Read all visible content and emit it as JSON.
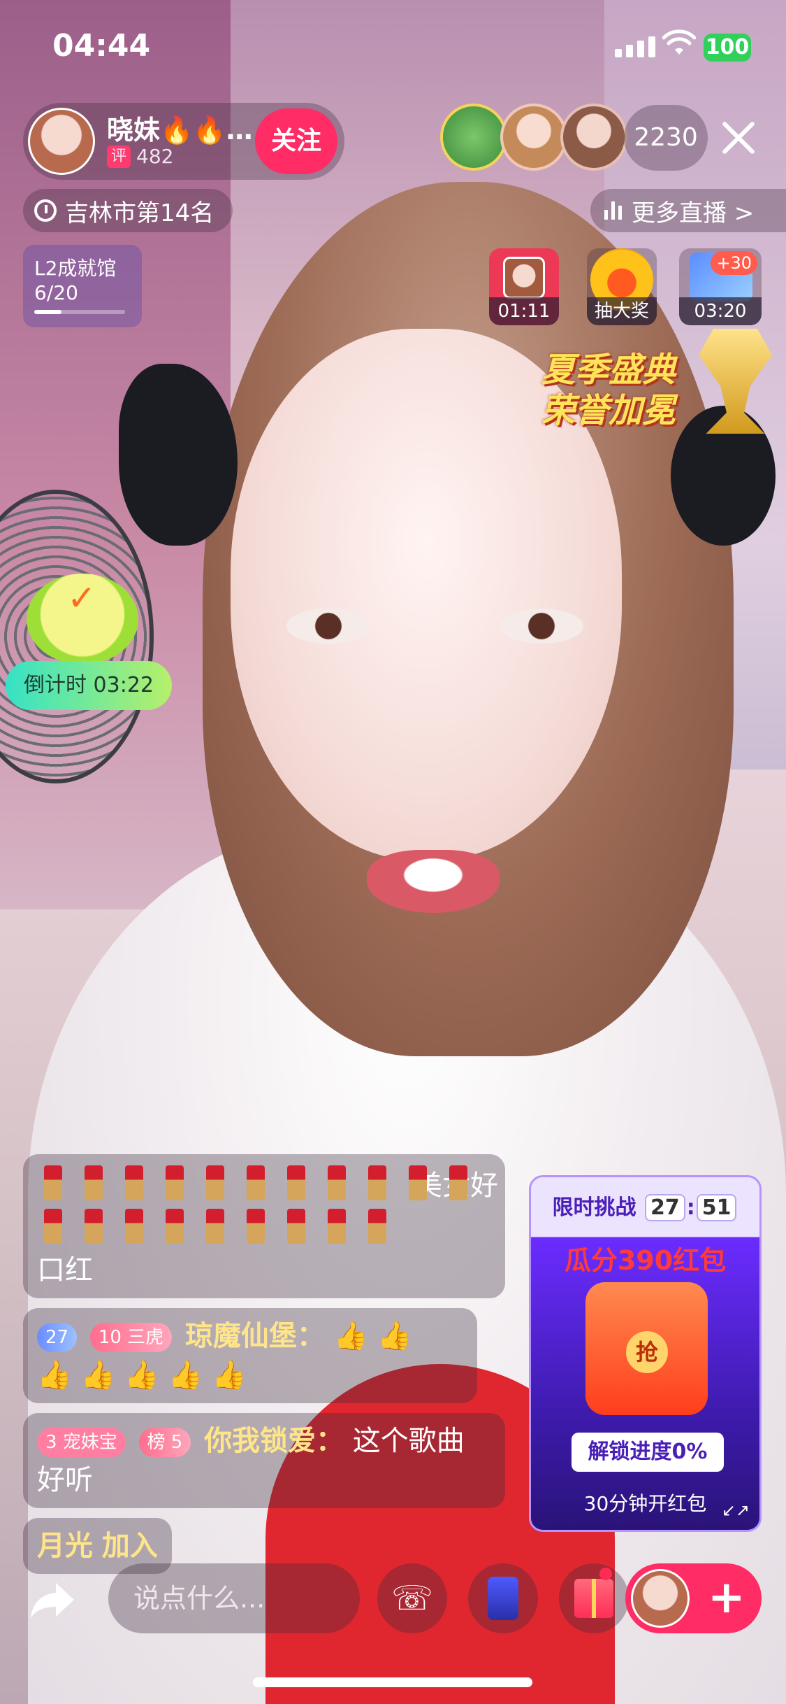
{
  "status_bar": {
    "time": "04:44",
    "battery": "100"
  },
  "host": {
    "name": "晓妹🔥🔥…",
    "rating_badge": "评",
    "rating_count": "482",
    "follow_label": "关注"
  },
  "viewers": {
    "count": "2230"
  },
  "rank": {
    "label": "吉林市第14名"
  },
  "more_live": {
    "label": "更多直播 >"
  },
  "level_task": {
    "title": "L2成就馆",
    "progress": "6/20",
    "progress_fraction": 0.3
  },
  "tiles": [
    {
      "label": "01:11"
    },
    {
      "label": "抽大奖"
    },
    {
      "label": "03:20",
      "badge": "+30"
    }
  ],
  "promo": {
    "line1": "夏季盛典",
    "line2": "荣誉加冕"
  },
  "countdown": {
    "label": "倒计时 03:22"
  },
  "chat": {
    "msg1_text": "美女好",
    "msg1_line2": "口红",
    "msg2_badge1": "27",
    "msg2_badge2": "10 三虎",
    "msg2_user": "琼魔仙堡：",
    "msg3_badge1": "3 宠妹宝",
    "msg3_badge2": "榜 5",
    "msg3_user": "你我锁爱：",
    "msg3_text": "这个歌曲",
    "msg3_line2": "好听",
    "join_user": "月光",
    "join_text": "加入"
  },
  "red_packet": {
    "header": "限时挑战",
    "timer_min": "27",
    "timer_sep": ":",
    "timer_sec": "51",
    "title": "瓜分390红包",
    "progress_label": "解锁进度0%",
    "footer": "30分钟开红包"
  },
  "bottom_bar": {
    "input_placeholder": "说点什么..."
  }
}
